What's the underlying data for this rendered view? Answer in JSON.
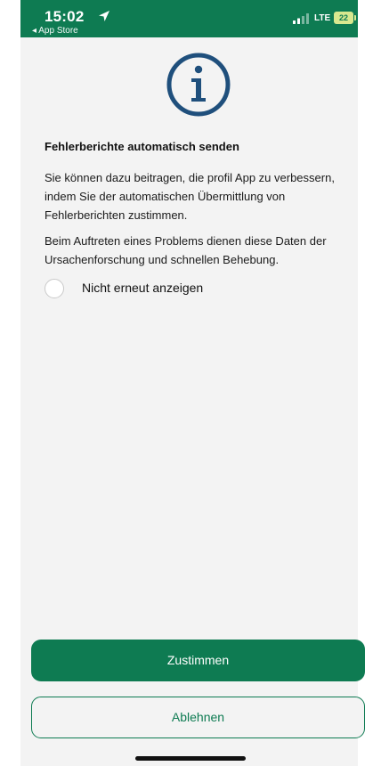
{
  "status_bar": {
    "time": "15:02",
    "back_label": "◂ App Store",
    "network": "LTE",
    "battery": "22"
  },
  "dialog": {
    "icon": "info-icon",
    "title": "Fehlerberichte automatisch senden",
    "paragraph1": "Sie können dazu beitragen, die profil App zu verbessern, indem Sie der automatischen Übermittlung von Fehlerberichten zustimmen.",
    "paragraph2": "Beim Auftreten eines Problems dienen diese Daten der Ursachenforschung und schnellen Behebung.",
    "checkbox_label": "Nicht erneut anzeigen",
    "checkbox_checked": false
  },
  "buttons": {
    "accept": "Zustimmen",
    "decline": "Ablehnen"
  },
  "colors": {
    "brand": "#0e7b52",
    "icon_blue": "#1f4f7c",
    "background": "#f3f3f3"
  }
}
